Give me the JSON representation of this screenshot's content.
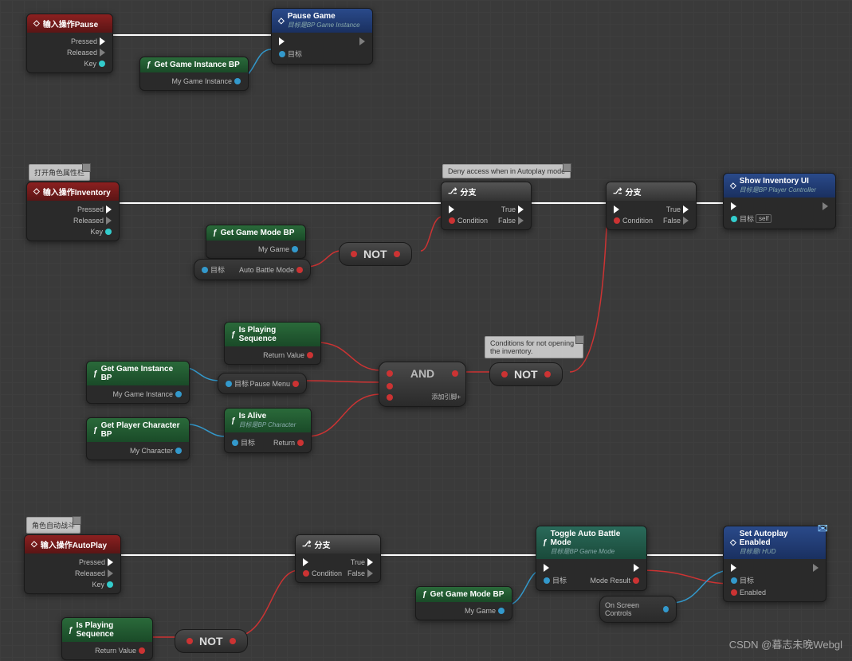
{
  "comments": {
    "open_attr": "打开角色属性栏",
    "deny_autoplay": "Deny access when in Autoplay mode",
    "not_open_inv": "Conditions for not opening the inventory.",
    "auto_combat": "角色自动战斗"
  },
  "nodes": {
    "input_pause": {
      "title": "输入操作Pause",
      "pressed": "Pressed",
      "released": "Released",
      "key": "Key"
    },
    "pause_game": {
      "title": "Pause Game",
      "sub": "目标是BP Game Instance",
      "target": "目标"
    },
    "get_gi_bp1": {
      "title": "Get Game Instance BP",
      "out": "My Game Instance"
    },
    "input_inv": {
      "title": "输入操作Inventory",
      "pressed": "Pressed",
      "released": "Released",
      "key": "Key"
    },
    "get_gm_bp1": {
      "title": "Get Game Mode BP",
      "out": "My Game"
    },
    "auto_battle": {
      "target": "目标",
      "out": "Auto Battle Mode"
    },
    "not1": "NOT",
    "branch1": {
      "title": "分支",
      "true": "True",
      "false": "False",
      "cond": "Condition"
    },
    "branch2": {
      "title": "分支",
      "true": "True",
      "false": "False",
      "cond": "Condition"
    },
    "show_inv": {
      "title": "Show Inventory UI",
      "sub": "目标是BP Player Controller",
      "target": "目标",
      "self": "self"
    },
    "is_playing1": {
      "title": "Is Playing Sequence",
      "out": "Return Value"
    },
    "get_gi_bp2": {
      "title": "Get Game Instance BP",
      "out": "My Game Instance"
    },
    "pause_menu": {
      "target": "目标",
      "out": "Pause Menu"
    },
    "get_pc_bp": {
      "title": "Get Player Character BP",
      "out": "My Character"
    },
    "is_alive": {
      "title": "Is Alive",
      "sub": "目标是BP Character",
      "target": "目标",
      "out": "Return"
    },
    "and": {
      "title": "AND",
      "add": "添加引脚"
    },
    "not2": "NOT",
    "input_auto": {
      "title": "输入操作AutoPlay",
      "pressed": "Pressed",
      "released": "Released",
      "key": "Key"
    },
    "branch3": {
      "title": "分支",
      "true": "True",
      "false": "False",
      "cond": "Condition"
    },
    "toggle_auto": {
      "title": "Toggle Auto Battle Mode",
      "sub": "目标是BP Game Mode",
      "target": "目标",
      "out": "Mode Result"
    },
    "get_gm_bp2": {
      "title": "Get Game Mode BP",
      "out": "My Game"
    },
    "set_auto": {
      "title": "Set Autoplay Enabled",
      "sub": "目标是I HUD",
      "target": "目标",
      "enabled": "Enabled"
    },
    "on_screen": "On Screen Controls",
    "is_playing2": {
      "title": "Is Playing Sequence",
      "out": "Return Value"
    },
    "not3": "NOT"
  },
  "watermark": "CSDN @暮志未晚Webgl"
}
